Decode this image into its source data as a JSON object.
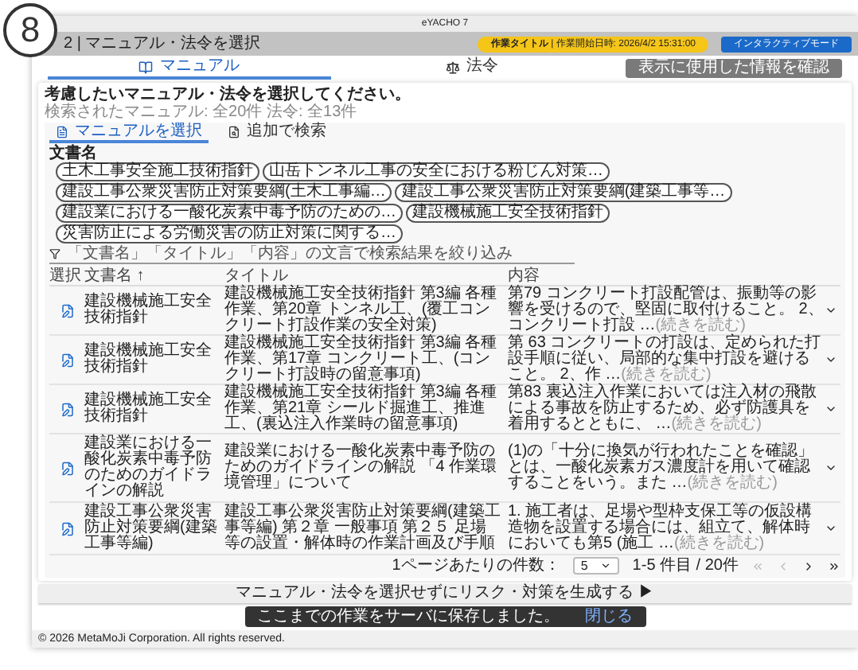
{
  "step_badge": "8",
  "window": {
    "title": "eYACHO 7"
  },
  "header": {
    "title": "2 | マニュアル・法令を選択",
    "work_title": "作業タイトル",
    "work_start": "| 作業開始日時: 2026/4/2 15:31:00",
    "mode_button": "インタラクティブモード"
  },
  "tabs": [
    {
      "label": "マニュアル",
      "selected": true
    },
    {
      "label": "法令",
      "selected": false
    }
  ],
  "info_button": "表示に使用した情報を確認",
  "card": {
    "heading": "考慮したいマニュアル・法令を選択してください。",
    "subtitle": "検索されたマニュアル: 全20件 法令: 全13件"
  },
  "sub_tabs": [
    {
      "label": "マニュアルを選択",
      "selected": true
    },
    {
      "label": "追加で検索",
      "selected": false
    }
  ],
  "filter_label": "文書名",
  "chips": [
    "土木工事安全施工技術指針",
    "山岳トンネル工事の安全における粉じん対策…",
    "建設工事公衆災害防止対策要綱(土木工事編…",
    "建設工事公衆災害防止対策要綱(建築工事等…",
    "建設業における一酸化炭素中毒予防のための…",
    "建設機械施工安全技術指針",
    "災害防止による労働災害の防止対策に関する…"
  ],
  "search": {
    "placeholder": "「文書名」「タイトル」「内容」の文言で検索結果を絞り込み"
  },
  "table": {
    "columns": [
      "選択",
      "文書名 ↑",
      "タイトル",
      "内容"
    ],
    "rows": [
      {
        "doc": "建設機械施工安全技術指針",
        "title": "建設機械施工安全技術指針 第3編 各種作業、第20章 トンネル工、(覆工コンクリート打設作業の安全対策)",
        "content": "第79 コンクリート打設配管は、振動等の影響を受けるので、堅固に取付けること。 2、コンクリート打設 …",
        "more": "(続きを読む)"
      },
      {
        "doc": "建設機械施工安全技術指針",
        "title": "建設機械施工安全技術指針 第3編 各種作業、第17章 コンクリート工、(コンクリート打設時の留意事項)",
        "content": "第 63 コンクリートの打設は、定められた打設手順に従い、局部的な集中打設を避けること。 2、作 …",
        "more": "(続きを読む)"
      },
      {
        "doc": "建設機械施工安全技術指針",
        "title": "建設機械施工安全技術指針 第3編 各種作業、第21章 シールド掘進工、推進工、(裏込注入作業時の留意事項)",
        "content": "第83 裏込注入作業においては注入材の飛散による事故を防止するため、必ず防護具を着用するとともに、 …",
        "more": "(続きを読む)"
      },
      {
        "doc": "建設業における一酸化炭素中毒予防のためのガイドラインの解説",
        "title": "建設業における一酸化炭素中毒予防のためのガイドラインの解説 「4 作業環境管理」について",
        "content": "(1)の「十分に換気が行われたことを確認」とは、一酸化炭素ガス濃度計を用いて確認することをいう。また …",
        "more": "(続きを読む)"
      },
      {
        "doc": "建設工事公衆災害防止対策要綱(建築工事等編)",
        "title": "建設工事公衆災害防止対策要綱(建築工事等編) 第２章 一般事項 第２５ 足場等の設置・解体時の作業計画及び手順",
        "content": "1. 施工者は、足場や型枠支保工等の仮設構造物を設置する場合には、組立て、解体時においても第5 (施工 …",
        "more": "(続きを読む)"
      }
    ]
  },
  "pagination": {
    "label": "1ページあたりの件数：",
    "per_page": "5",
    "range": "1-5 件目 / 20件"
  },
  "generate_button": "マニュアル・法令を選択せずにリスク・対策を生成する ▶",
  "snackbar": {
    "message": "ここまでの作業をサーバに保存しました。",
    "action": "閉じる"
  },
  "footer": "© 2026 MetaMoJi Corporation. All rights reserved."
}
